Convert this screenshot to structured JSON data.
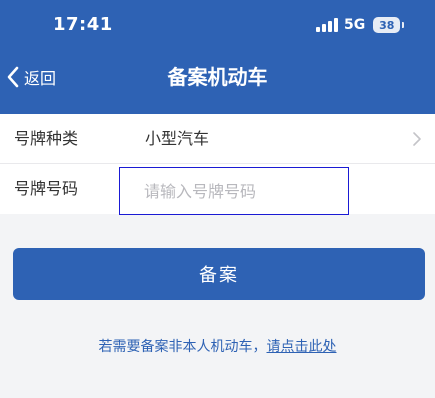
{
  "status_bar": {
    "time": "17:41",
    "network": "5G",
    "battery": "38"
  },
  "nav": {
    "back_label": "返回",
    "title": "备案机动车"
  },
  "form": {
    "plate_type": {
      "label": "号牌种类",
      "value": "小型汽车"
    },
    "plate_number": {
      "label": "号牌号码",
      "placeholder": "请输入号牌号码"
    }
  },
  "submit_label": "备案",
  "hint": {
    "text": "若需要备案非本人机动车，",
    "link": "请点击此处"
  },
  "colors": {
    "primary": "#2e62b4",
    "focus_border": "#1a1ad4",
    "background": "#f3f4f6"
  },
  "icons": {
    "back": "chevron-left-icon",
    "row_arrow": "chevron-right-icon",
    "signal": "signal-icon",
    "battery": "battery-icon"
  }
}
